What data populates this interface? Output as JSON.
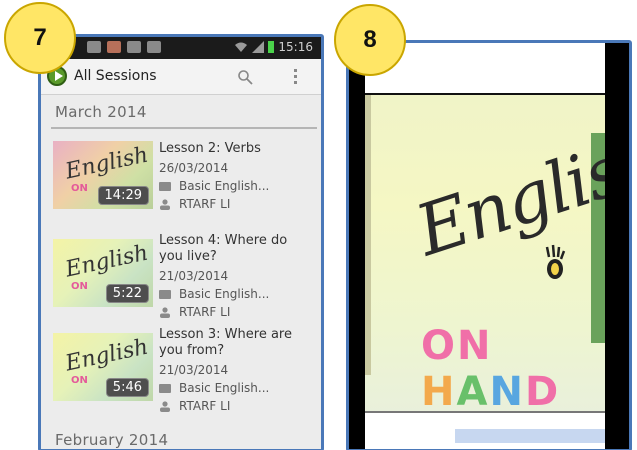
{
  "badges": {
    "left": "7",
    "right": "8"
  },
  "phone1": {
    "status": {
      "time": "15:16"
    },
    "actionbar": {
      "title": "All Sessions",
      "icons": [
        "app-logo",
        "search-icon",
        "overflow-menu-icon"
      ]
    },
    "sections": [
      {
        "header": "March 2014",
        "sessions": [
          {
            "title": "Lesson 2: Verbs",
            "date": "26/03/2014",
            "course": "Basic English...",
            "author": "RTARF LI",
            "duration": "14:29",
            "thumb_word": "English",
            "thumb_sub": "ON"
          },
          {
            "title": "Lesson 4: Where do you live?",
            "date": "21/03/2014",
            "course": "Basic English...",
            "author": "RTARF LI",
            "duration": "5:22",
            "thumb_word": "English",
            "thumb_sub": "ON"
          },
          {
            "title": "Lesson 3: Where are you from?",
            "date": "21/03/2014",
            "course": "Basic English...",
            "author": "RTARF LI",
            "duration": "5:46",
            "thumb_word": "English",
            "thumb_sub": "ON"
          }
        ]
      },
      {
        "header": "February 2014",
        "sessions": []
      }
    ]
  },
  "phone2": {
    "video": {
      "title_word": "English",
      "subtitle_letters": [
        "ON",
        "H",
        "A",
        "N",
        "D"
      ]
    }
  }
}
